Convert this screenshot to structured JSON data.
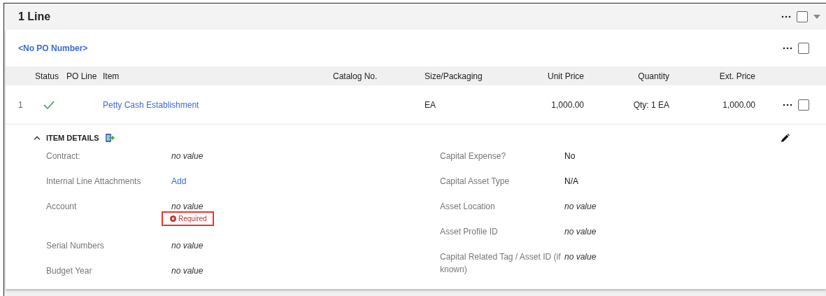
{
  "section": {
    "title": "1 Line",
    "selected": false
  },
  "po_group": {
    "po_number": "<No PO Number>",
    "selected": false
  },
  "table": {
    "columns": [
      "Status",
      "PO Line",
      "Item",
      "Catalog No.",
      "Size/Packaging",
      "Unit Price",
      "Quantity",
      "Ext. Price"
    ],
    "rows": [
      {
        "line_number": "1",
        "status": {
          "kind": "complete"
        },
        "item": "Petty Cash Establishment",
        "size_packaging": "EA",
        "unit_price": "1,000.00",
        "quantity": "Qty: 1 EA",
        "ext_price": "1,000.00",
        "selected": false
      }
    ]
  },
  "item_details": {
    "title": "ITEM DETAILS",
    "expanded": true,
    "left_fields": [
      {
        "label": "Contract:",
        "value": "no value",
        "kind": "empty"
      },
      {
        "label": "Internal Line Attachments",
        "value": "Add",
        "kind": "link"
      },
      {
        "label": "Account",
        "value": "no value",
        "kind": "empty",
        "error": "Required"
      },
      {
        "label": "Serial Numbers",
        "value": "no value",
        "kind": "empty"
      },
      {
        "label": "Budget Year",
        "value": "no value",
        "kind": "empty"
      }
    ],
    "right_fields": [
      {
        "label": "Capital Expense?",
        "value": "No",
        "kind": "text"
      },
      {
        "label": "Capital Asset Type",
        "value": "N/A",
        "kind": "text"
      },
      {
        "label": "Asset Location",
        "value": "no value",
        "kind": "empty"
      },
      {
        "label": "Asset Profile ID",
        "value": "no value",
        "kind": "empty"
      },
      {
        "label": "Capital Related Tag / Asset ID (if known)",
        "value": "no value",
        "kind": "empty"
      }
    ]
  }
}
